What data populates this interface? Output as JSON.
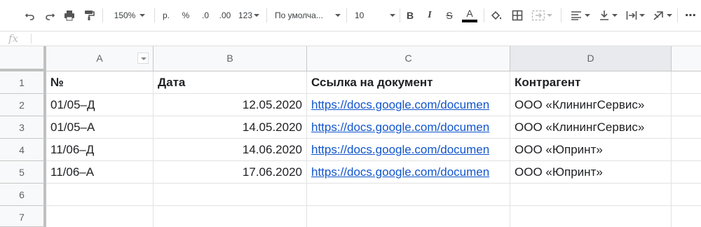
{
  "toolbar": {
    "zoom": "150%",
    "currency": "р.",
    "percent": "%",
    "decimal_decrease": ".0",
    "decimal_increase": ".00",
    "number_format": "123",
    "font": "По умолча...",
    "font_size": "10",
    "bold": "B",
    "italic": "I",
    "strike": "S",
    "text_color": "A",
    "more": "⋯"
  },
  "formula_bar": {
    "fx": "fx",
    "value": ""
  },
  "columns": [
    "A",
    "B",
    "C",
    "D"
  ],
  "rows": [
    "1",
    "2",
    "3",
    "4",
    "5",
    "6",
    "7"
  ],
  "cells": [
    [
      "№",
      "Дата",
      "Ссылка на документ",
      "Контрагент"
    ],
    [
      "01/05–Д",
      "12.05.2020",
      "https://docs.google.com/documen",
      "ООО «КлинингСервис»"
    ],
    [
      "01/05–А",
      "14.05.2020",
      "https://docs.google.com/documen",
      "ООО «КлинингСервис»"
    ],
    [
      "11/06–Д",
      "14.06.2020",
      "https://docs.google.com/documen",
      "ООО «Юпринт»"
    ],
    [
      "11/06–А",
      "17.06.2020",
      "https://docs.google.com/documen",
      "ООО «Юпринт»"
    ],
    [
      "",
      "",
      "",
      ""
    ],
    [
      "",
      "",
      "",
      ""
    ]
  ],
  "colors": {
    "link": "#1155cc",
    "header_bg": "#f8f9fa",
    "text_color_bar": "#000000"
  }
}
